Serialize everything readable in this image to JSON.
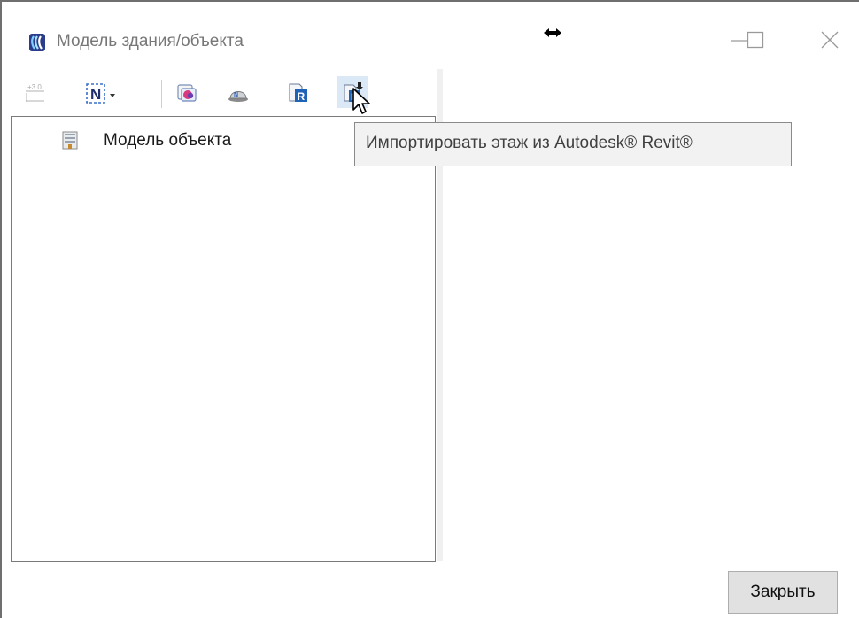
{
  "window": {
    "title": "Модель здания/объекта"
  },
  "toolbar": {
    "buttons": [
      {
        "name": "elevation-button",
        "icon": "elevation-icon"
      },
      {
        "name": "numbering-dropdown-button",
        "icon": "n-frame-dropdown-icon"
      },
      {
        "name": "layers-button",
        "icon": "layers-icon"
      },
      {
        "name": "import-nanocad-button",
        "icon": "nanocad-helmet-icon"
      },
      {
        "name": "revit-button",
        "icon": "revit-document-icon"
      },
      {
        "name": "import-floor-revit-button",
        "icon": "revit-import-icon",
        "hovered": true
      }
    ]
  },
  "tree": {
    "items": [
      {
        "label": "Модель объекта",
        "icon": "building-icon"
      }
    ]
  },
  "tooltip": {
    "text": "Импортировать этаж из Autodesk® Revit®"
  },
  "footer": {
    "close_label": "Закрыть"
  },
  "colors": {
    "hover_highlight": "#dbe9f7",
    "tooltip_bg": "#f2f2f2",
    "button_bg": "#e1e1e1",
    "revit_blue": "#1f63b7"
  }
}
